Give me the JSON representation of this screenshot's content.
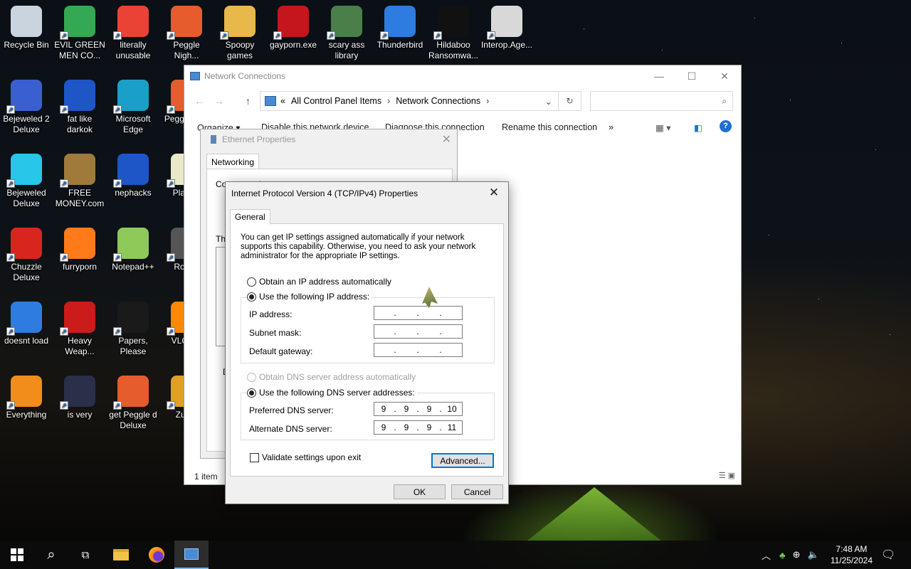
{
  "desktop": {
    "icons": [
      {
        "label": "Recycle Bin",
        "icon": "recycle-bin-icon",
        "color": "#c9d4df"
      },
      {
        "label": "EVIL GREEN MEN CO...",
        "icon": "green-men-icon",
        "color": "#34a853"
      },
      {
        "label": "literally unusable",
        "icon": "chrome-icon",
        "color": "#ea4335"
      },
      {
        "label": "Peggle Nigh...",
        "icon": "peggle-icon",
        "color": "#e65c2c"
      },
      {
        "label": "Spoopy games",
        "icon": "folder-icon",
        "color": "#e8b84a"
      },
      {
        "label": "gayporn.exe",
        "icon": "flash-icon",
        "color": "#c4161c"
      },
      {
        "label": "scary ass library",
        "icon": "library-shield-icon",
        "color": "#4a7f4a"
      },
      {
        "label": "Thunderbird",
        "icon": "thunderbird-icon",
        "color": "#2f7ce0"
      },
      {
        "label": "Hildaboo Ransomwa...",
        "icon": "yashma-icon",
        "color": "#111111"
      },
      {
        "label": "Interop.Age...",
        "icon": "settings-file-icon",
        "color": "#d8d8d8"
      },
      {
        "label": "Bejeweled 2 Deluxe",
        "icon": "bejeweled2-icon",
        "color": "#3a5fd0"
      },
      {
        "label": "fat like darkok",
        "icon": "mpi-icon",
        "color": "#1e56c8"
      },
      {
        "label": "Microsoft Edge",
        "icon": "edge-icon",
        "color": "#1aa0c8"
      },
      {
        "label": "Pegg of Wa",
        "icon": "peggle-wa-icon",
        "color": "#e65c2c"
      },
      {
        "label": "Bejeweled Deluxe",
        "icon": "diamond-icon",
        "color": "#28c6e8"
      },
      {
        "label": "FREE MONEY.com",
        "icon": "money-bag-icon",
        "color": "#a07a3a"
      },
      {
        "label": "nephacks",
        "icon": "mpi-icon",
        "color": "#1e56c8"
      },
      {
        "label": "Pla Zor",
        "icon": "flower-icon",
        "color": "#e9e9c8"
      },
      {
        "label": "Chuzzle Deluxe",
        "icon": "chuzzle-icon",
        "color": "#d8261e"
      },
      {
        "label": "furryporn",
        "icon": "firefox-icon",
        "color": "#ff7a18"
      },
      {
        "label": "Notepad++",
        "icon": "notepad-plus-icon",
        "color": "#8fc95a"
      },
      {
        "label": "Ro Ma",
        "icon": "game-icon",
        "color": "#555555"
      },
      {
        "label": "doesnt load",
        "icon": "thunderbird-icon",
        "color": "#2f7ce0"
      },
      {
        "label": "Heavy Weap...",
        "icon": "radiation-icon",
        "color": "#cc1b1b"
      },
      {
        "label": "Papers, Please",
        "icon": "papers-please-icon",
        "color": "#1a1a1a"
      },
      {
        "label": "VLC pla",
        "icon": "vlc-icon",
        "color": "#ff8800"
      },
      {
        "label": "Everything",
        "icon": "search-magnifier-icon",
        "color": "#f28c1a"
      },
      {
        "label": "is very",
        "icon": "mpi-shield-icon",
        "color": "#2a2f4a"
      },
      {
        "label": "get Peggle d Deluxe",
        "icon": "peggle-icon",
        "color": "#e65c2c"
      },
      {
        "label": "Zuma",
        "icon": "zuma-icon",
        "color": "#e0a020"
      }
    ]
  },
  "explorer": {
    "title": "Network Connections",
    "breadcrumb": {
      "chevrons": "«",
      "items": [
        "All Control Panel Items",
        "Network Connections"
      ]
    },
    "search_placeholder": "",
    "commands": {
      "organize": "Organize ▾",
      "disable": "Disable this network device",
      "diagnose": "Diagnose this connection",
      "rename": "Rename this connection",
      "more": "»"
    },
    "status": "1 item"
  },
  "ethernet": {
    "title": "Ethernet Properties",
    "tab": "Networking",
    "frag_connect": "Connect using:",
    "frag_this": "Th",
    "frag_d": "D"
  },
  "ipv4": {
    "title": "Internet Protocol Version 4 (TCP/IPv4) Properties",
    "tab": "General",
    "description": "You can get IP settings assigned automatically if your network supports this capability. Otherwise, you need to ask your network administrator for the appropriate IP settings.",
    "ip_auto_label": "Obtain an IP address automatically",
    "ip_manual_label": "Use the following IP address:",
    "ip_address_label": "IP address:",
    "ip_address": [
      "",
      "",
      "",
      ""
    ],
    "subnet_label": "Subnet mask:",
    "subnet": [
      "",
      "",
      "",
      ""
    ],
    "gateway_label": "Default gateway:",
    "gateway": [
      "",
      "",
      "",
      ""
    ],
    "dns_auto_label": "Obtain DNS server address automatically",
    "dns_manual_label": "Use the following DNS server addresses:",
    "preferred_label": "Preferred DNS server:",
    "preferred": [
      "9",
      "9",
      "9",
      "10"
    ],
    "alternate_label": "Alternate DNS server:",
    "alternate": [
      "9",
      "9",
      "9",
      "11"
    ],
    "validate_label": "Validate settings upon exit",
    "advanced_label": "Advanced...",
    "ok_label": "OK",
    "cancel_label": "Cancel",
    "ip_mode": "manual",
    "dns_mode": "manual",
    "validate_checked": false
  },
  "taskbar": {
    "time": "7:48 AM",
    "date": "11/25/2024",
    "accent": "#7fb4e6"
  }
}
